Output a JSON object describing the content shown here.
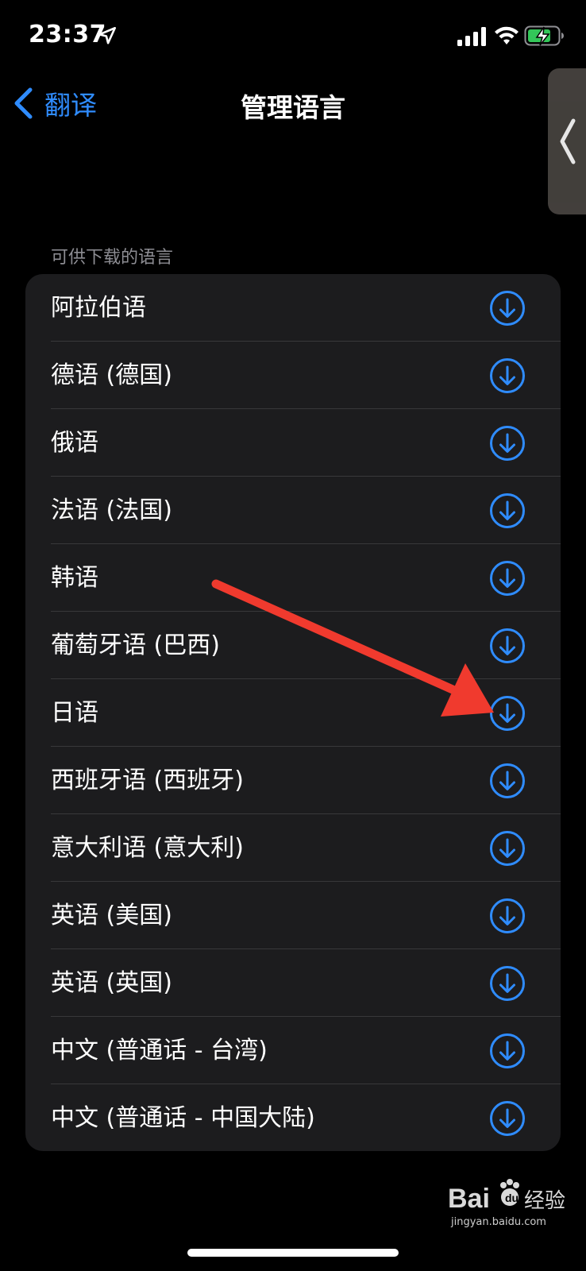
{
  "status_bar": {
    "time": "23:37",
    "icons": [
      "location-arrow-icon",
      "cellular-signal-icon",
      "wifi-icon",
      "battery-charging-icon"
    ]
  },
  "nav": {
    "back_label": "翻译",
    "title": "管理语言"
  },
  "section": {
    "header": "可供下载的语言",
    "items": [
      {
        "label": "阿拉伯语"
      },
      {
        "label": "德语 (德国)"
      },
      {
        "label": "俄语"
      },
      {
        "label": "法语 (法国)"
      },
      {
        "label": "韩语"
      },
      {
        "label": "葡萄牙语 (巴西)"
      },
      {
        "label": "日语"
      },
      {
        "label": "西班牙语 (西班牙)"
      },
      {
        "label": "意大利语 (意大利)"
      },
      {
        "label": "英语 (美国)"
      },
      {
        "label": "英语 (英国)"
      },
      {
        "label": "中文 (普通话 - 台湾)"
      },
      {
        "label": "中文 (普通话 - 中国大陆)"
      }
    ]
  },
  "watermark": {
    "brand": "Bai",
    "brand_tail": "du",
    "suffix": "经验",
    "domain": "jingyan.baidu.com"
  },
  "colors": {
    "accent": "#2f8cff",
    "background": "#000000",
    "card": "#1c1c1e",
    "section_header": "#8d8d93",
    "annotation": "#f03a2e"
  }
}
